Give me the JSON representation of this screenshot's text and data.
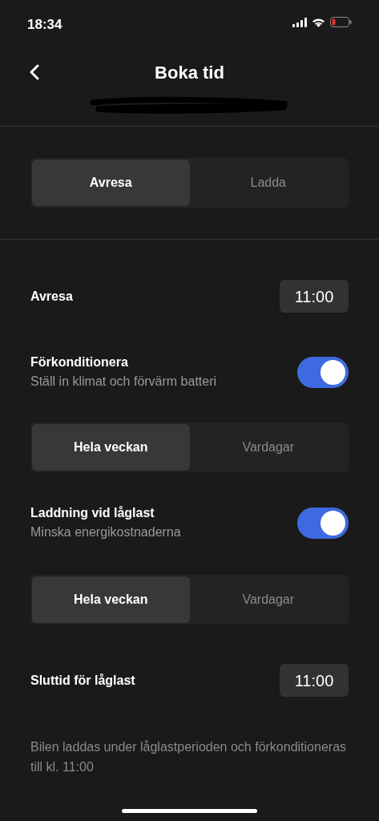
{
  "status_bar": {
    "time": "18:34"
  },
  "header": {
    "title": "Boka tid"
  },
  "mode_tabs": [
    {
      "label": "Avresa",
      "selected": true
    },
    {
      "label": "Ladda",
      "selected": false
    }
  ],
  "settings": [
    {
      "kind": "time",
      "label": "Avresa",
      "value": "11:00"
    },
    {
      "kind": "toggle",
      "label": "Förkonditionera",
      "description": "Ställ in klimat och förvärm batteri",
      "on": true
    },
    {
      "kind": "segment",
      "options": [
        {
          "label": "Hela veckan",
          "selected": true
        },
        {
          "label": "Vardagar",
          "selected": false
        }
      ]
    },
    {
      "kind": "toggle",
      "label": "Laddning vid låglast",
      "description": "Minska energikostnaderna",
      "on": true
    },
    {
      "kind": "segment",
      "options": [
        {
          "label": "Hela veckan",
          "selected": true
        },
        {
          "label": "Vardagar",
          "selected": false
        }
      ]
    },
    {
      "kind": "time",
      "label": "Sluttid för låglast",
      "value": "11:00"
    }
  ],
  "footnote": "Bilen laddas under låglastperioden och förkonditioneras till kl. 11:00"
}
